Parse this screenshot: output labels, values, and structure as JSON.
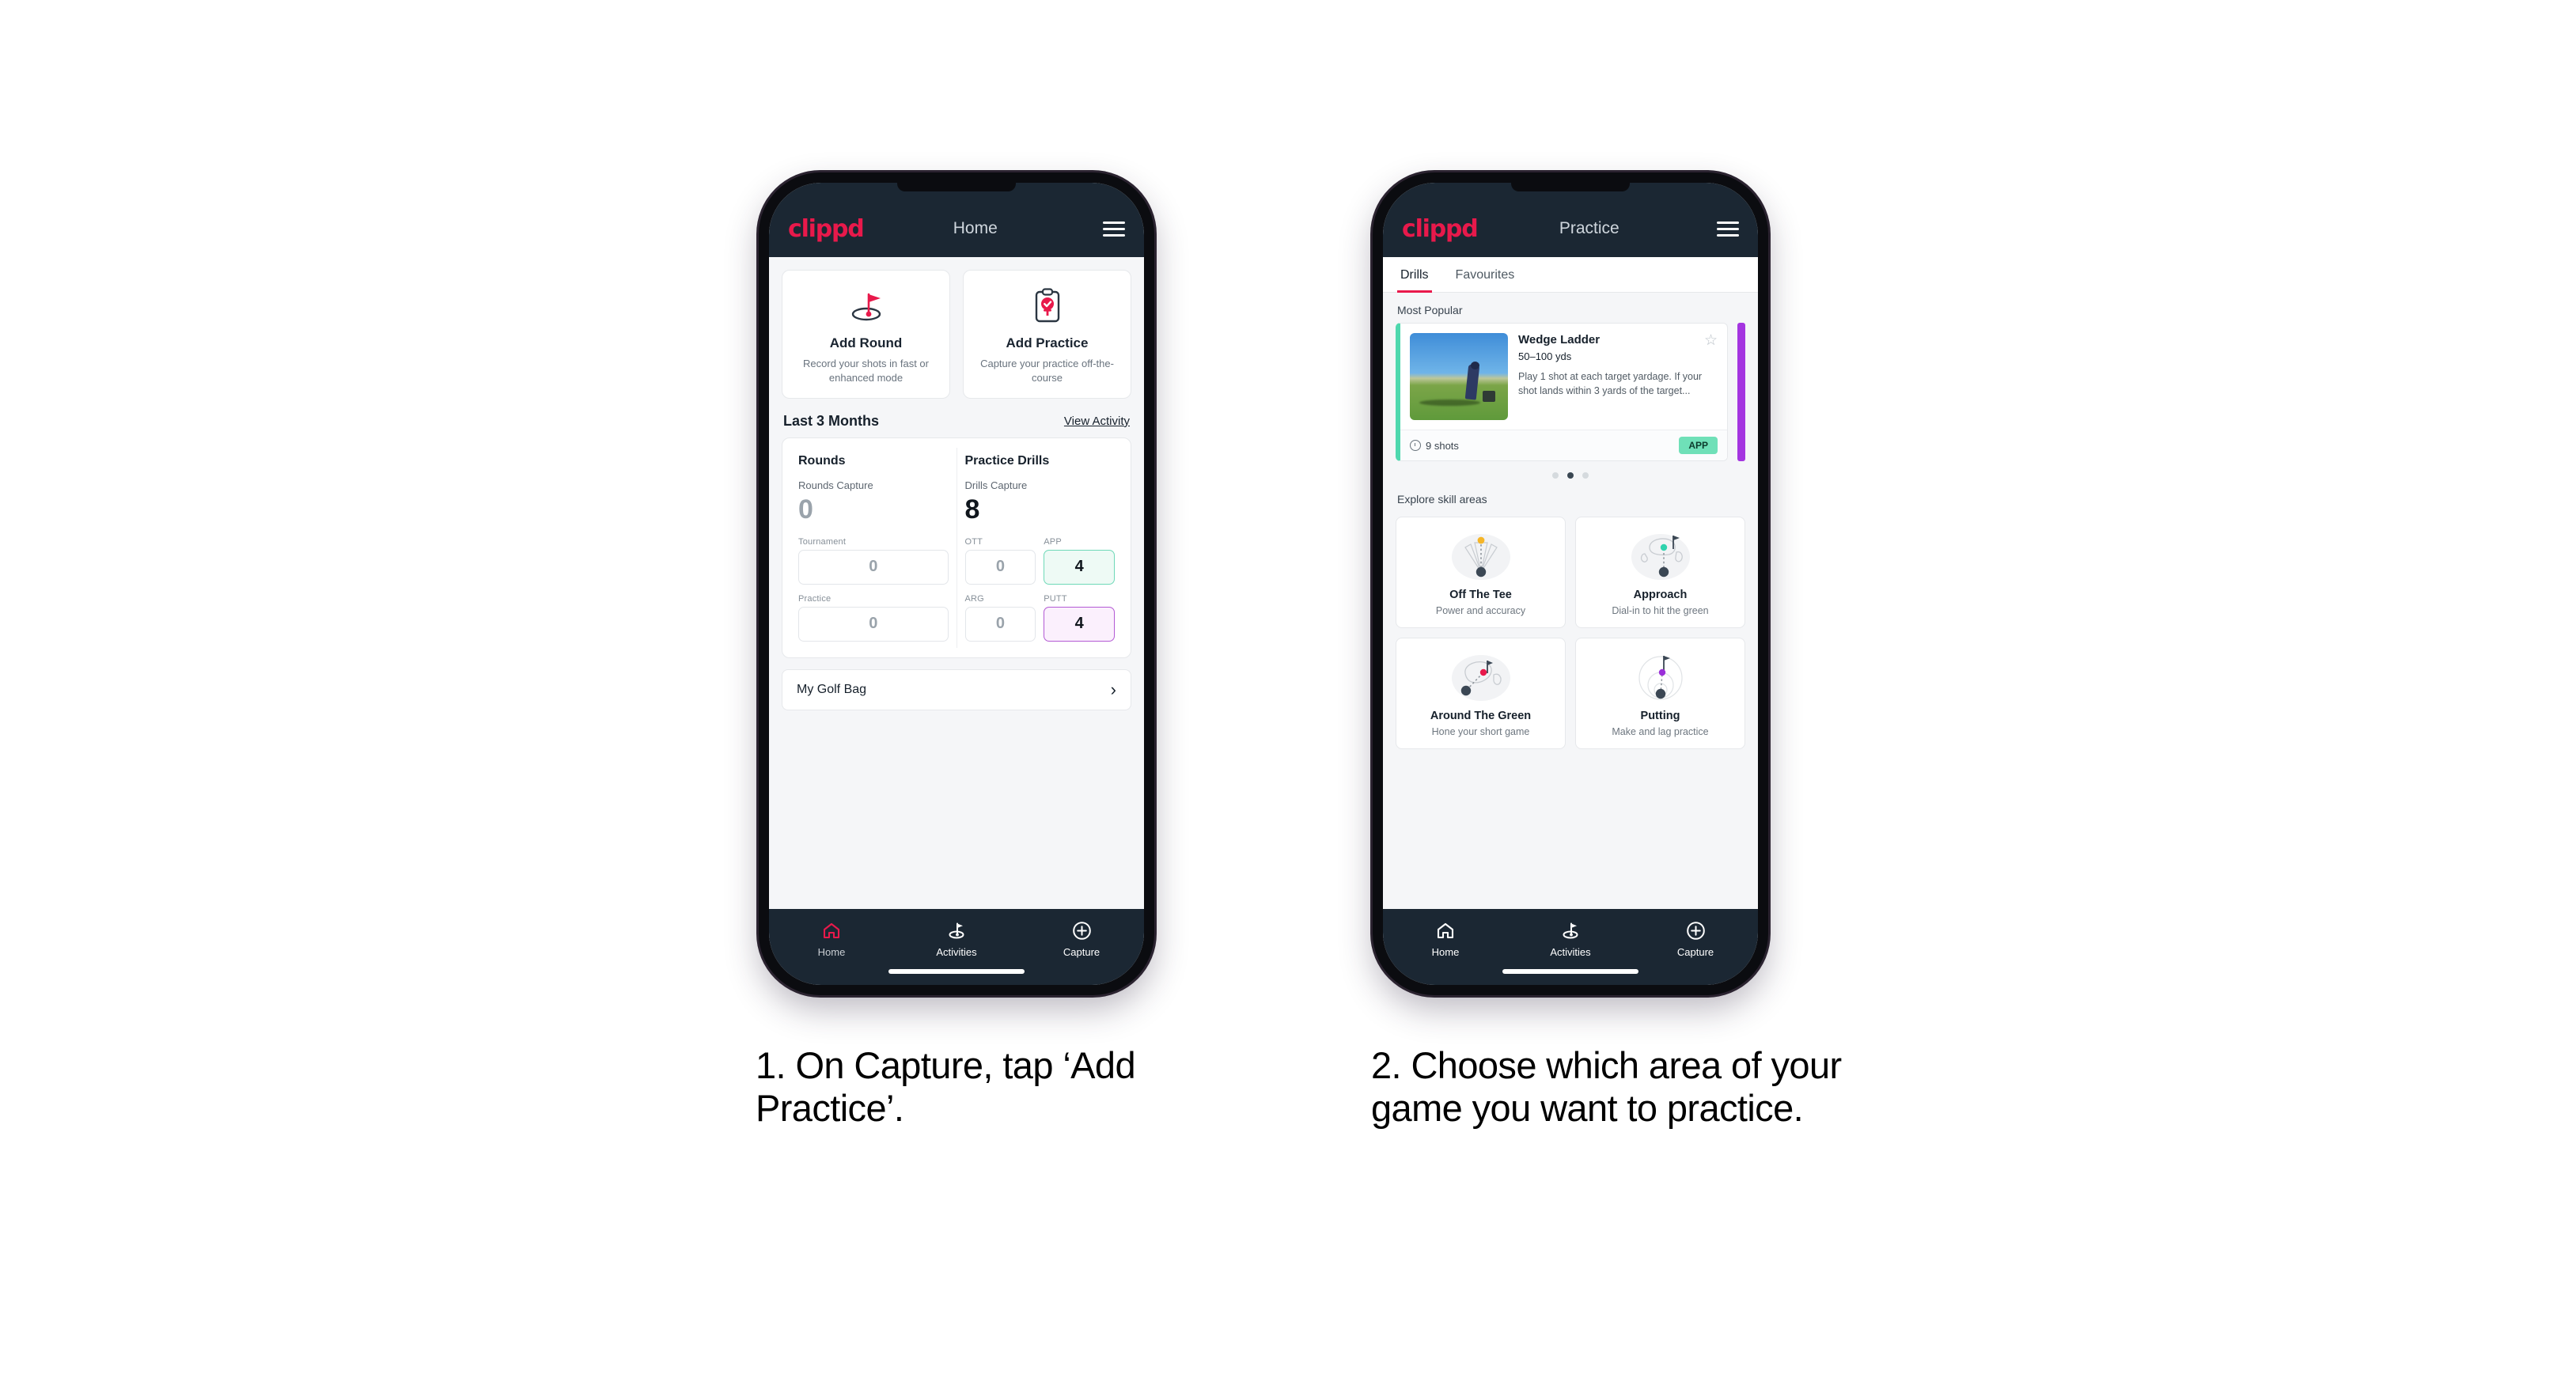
{
  "brand": {
    "logo": "clippd",
    "accent": "#e8194b",
    "nav_bg": "#1b2733"
  },
  "phone1": {
    "header": {
      "title": "Home",
      "menu_icon": "hamburger-icon"
    },
    "actions": [
      {
        "icon": "golf-flag-icon",
        "title": "Add Round",
        "subtitle": "Record your shots in fast or enhanced mode"
      },
      {
        "icon": "clipboard-check-icon",
        "title": "Add Practice",
        "subtitle": "Capture your practice off-the-course"
      }
    ],
    "section": {
      "title": "Last 3 Months",
      "link": "View Activity"
    },
    "stats": {
      "rounds": {
        "title": "Rounds",
        "capture_label": "Rounds Capture",
        "capture_value": "0",
        "items": [
          {
            "label": "Tournament",
            "value": "0",
            "state": "empty"
          },
          {
            "label": "Practice",
            "value": "0",
            "state": "empty"
          }
        ]
      },
      "drills": {
        "title": "Practice Drills",
        "capture_label": "Drills Capture",
        "capture_value": "8",
        "items": [
          {
            "label": "OTT",
            "value": "0",
            "state": "empty"
          },
          {
            "label": "APP",
            "value": "4",
            "state": "app"
          },
          {
            "label": "ARG",
            "value": "0",
            "state": "empty"
          },
          {
            "label": "PUTT",
            "value": "4",
            "state": "putt"
          }
        ]
      }
    },
    "golf_bag": {
      "label": "My Golf Bag",
      "chevron": "chevron-right-icon"
    },
    "nav": [
      {
        "icon": "home-icon",
        "label": "Home",
        "active": true
      },
      {
        "icon": "golf-flag-icon",
        "label": "Activities",
        "active": false
      },
      {
        "icon": "plus-circle-icon",
        "label": "Capture",
        "active": false
      }
    ]
  },
  "phone2": {
    "header": {
      "title": "Practice",
      "menu_icon": "hamburger-icon"
    },
    "tabs": [
      {
        "label": "Drills",
        "active": true
      },
      {
        "label": "Favourites",
        "active": false
      }
    ],
    "most_popular": {
      "title": "Most Popular",
      "drill": {
        "name": "Wedge Ladder",
        "yardage": "50–100 yds",
        "description": "Play 1 shot at each target yardage. If your shot lands within 3 yards of the target...",
        "shots": "9 shots",
        "badge": "APP",
        "badge_color": "#6fe0b8",
        "accent_color": "#4ed8ae",
        "favourite_icon": "star-outline-icon",
        "shots_icon": "clock-icon"
      },
      "next_card_accent": "#a435e0",
      "dots": {
        "count": 3,
        "active_index": 1
      }
    },
    "skills": {
      "title": "Explore skill areas",
      "cards": [
        {
          "icon": "off-the-tee-icon",
          "name": "Off The Tee",
          "sub": "Power and accuracy",
          "dot_color": "#f5b528"
        },
        {
          "icon": "approach-icon",
          "name": "Approach",
          "sub": "Dial-in to hit the green",
          "dot_color": "#2fd3ae"
        },
        {
          "icon": "around-the-green-icon",
          "name": "Around The Green",
          "sub": "Hone your short game",
          "dot_color": "#e8194b"
        },
        {
          "icon": "putting-icon",
          "name": "Putting",
          "sub": "Make and lag practice",
          "dot_color": "#9b30d9"
        }
      ]
    },
    "nav": [
      {
        "icon": "home-icon",
        "label": "Home",
        "active": false
      },
      {
        "icon": "golf-flag-icon",
        "label": "Activities",
        "active": false
      },
      {
        "icon": "plus-circle-icon",
        "label": "Capture",
        "active": false
      }
    ]
  },
  "captions": {
    "one": "1. On Capture, tap ‘Add Practice’.",
    "two": "2. Choose which area of your game you want to practice."
  }
}
